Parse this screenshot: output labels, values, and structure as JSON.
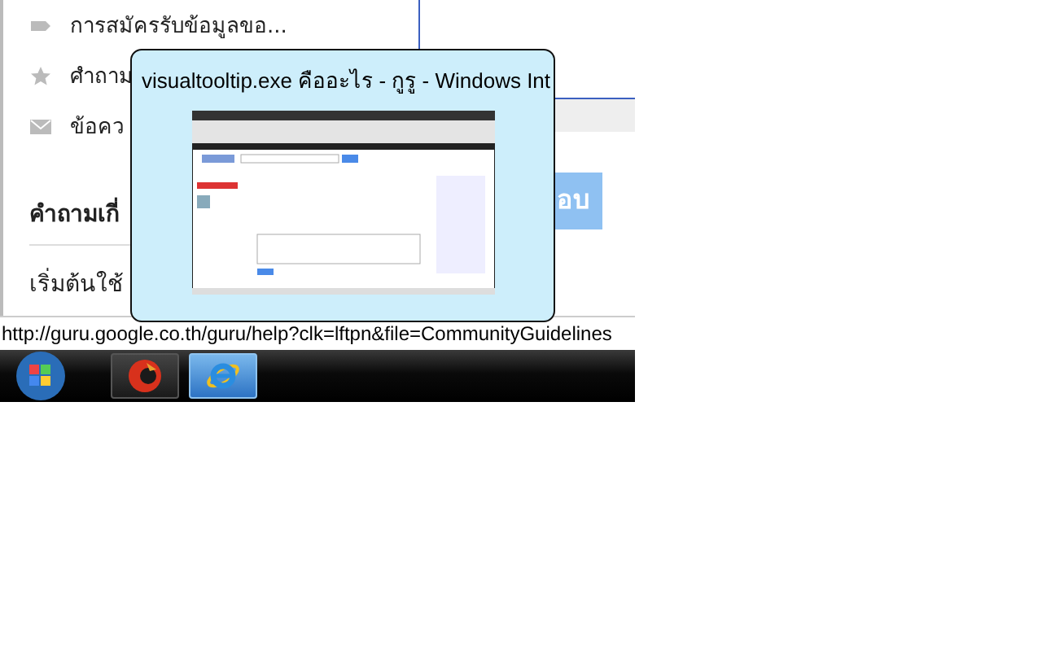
{
  "nav": {
    "items": [
      {
        "label": "การสมัครรับข้อมูลขอ..."
      },
      {
        "label": "ศำถาม"
      },
      {
        "label": "ข้อคว"
      }
    ]
  },
  "section_title": "คำถามเกี่",
  "links": [
    "เริ่มต้นใช้"
  ],
  "answer_button": "อบ",
  "tooltip": {
    "title": "visualtooltip.exe คืออะไร - กูรู - Windows Int"
  },
  "status_bar": {
    "url": "http://guru.google.co.th/guru/help?clk=lftpn&file=CommunityGuidelines"
  },
  "taskbar": {
    "buttons": [
      {
        "selected": false
      },
      {
        "selected": true
      }
    ]
  }
}
